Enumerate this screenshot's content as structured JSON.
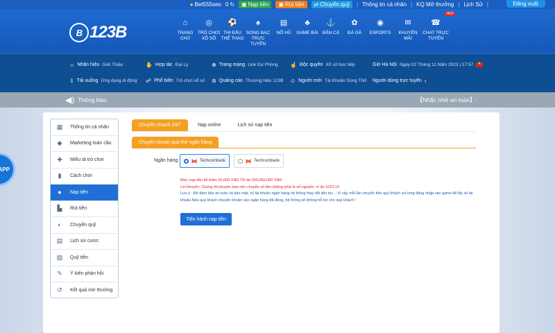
{
  "topbar": {
    "username": "Bet555seo",
    "balance": "0",
    "deposit": "Nạp tiền",
    "withdraw": "Rút tiền",
    "transfer": "Chuyển quỹ",
    "profile": "Thông tin cá nhân",
    "lottery_results": "KQ Mở thưởng",
    "history": "Lịch Sử",
    "logout": "Đăng xuất"
  },
  "logo": {
    "text": "123B",
    "mark": "B"
  },
  "nav": [
    {
      "icon": "home-icon",
      "line1": "TRANG CHỦ",
      "line2": ""
    },
    {
      "icon": "lottery-icon",
      "line1": "TRÒ CHƠI",
      "line2": "XỔ SỐ"
    },
    {
      "icon": "sports-icon",
      "line1": "THI ĐẤU",
      "line2": "THỂ THAO"
    },
    {
      "icon": "casino-icon",
      "line1": "SÒNG BẠC",
      "line2": "TRỰC TUYẾN"
    },
    {
      "icon": "slot-icon",
      "line1": "NỔ HŨ",
      "line2": ""
    },
    {
      "icon": "cards-icon",
      "line1": "GAME BÀI",
      "line2": ""
    },
    {
      "icon": "fish-icon",
      "line1": "BẮN CÁ",
      "line2": ""
    },
    {
      "icon": "cock-icon",
      "line1": "ĐÁ GÀ",
      "line2": ""
    },
    {
      "icon": "esports-icon",
      "line1": "ESPORTS",
      "line2": ""
    },
    {
      "icon": "gift-icon",
      "line1": "KHUYẾN MÃI",
      "line2": ""
    },
    {
      "icon": "chat-icon",
      "line1": "CHAT TRỰC",
      "line2": "TUYẾN"
    }
  ],
  "hot_badge": "HOT",
  "subbar": {
    "brand_label": "Nhãn hiệu",
    "brand_val": "Giới Thiệu",
    "download_label": "Tải xuống",
    "download_val": "Ứng dụng di động",
    "partner_label": "Hợp tác",
    "partner_val": "Đại Lý",
    "spread_label": "Phổ biến",
    "spread_val": "Trò chơi xổ số",
    "site_label": "Trang mạng",
    "site_val": "Link Dự Phòng",
    "ads_label": "Quảng cáo",
    "ads_val": "Thương hiệu 123B",
    "exclusive_label": "Độc quyền",
    "exclusive_val": "Xổ số trực tiếp",
    "newbie_label": "Người mới",
    "newbie_val": "Tài Khoản Dùng Thử",
    "time_label": "Giờ Hà Nội",
    "time_val": "Ngày 02 Tháng 11 Năm 2023 | 17:57",
    "online_label": "Người dùng trực tuyến"
  },
  "notice": {
    "label": "Thông báo:",
    "right": "【Nhắc nhở an toàn】:"
  },
  "app_badge": "APP",
  "sidebar": [
    {
      "icon": "profile-icon",
      "label": "Thông tin cá nhân"
    },
    {
      "icon": "diamond-icon",
      "label": "Marketing toàn cầu"
    },
    {
      "icon": "gamepad-icon",
      "label": "Miêu tả trò chơi"
    },
    {
      "icon": "book-icon",
      "label": "Cách chơi"
    },
    {
      "icon": "piggy-bank-icon",
      "label": "Nạp tiền"
    },
    {
      "icon": "withdraw-icon",
      "label": "Rút tiền"
    },
    {
      "icon": "transfer-icon",
      "label": "Chuyển quỹ"
    },
    {
      "icon": "history-icon",
      "label": "Lịch sử cược"
    },
    {
      "icon": "fund-icon",
      "label": "Quỹ tiền"
    },
    {
      "icon": "feedback-icon",
      "label": "Ý kiến phản hồi"
    },
    {
      "icon": "result-icon",
      "label": "Kết quả mở thưởng"
    }
  ],
  "tabs": [
    "Chuyển nhanh 24/7",
    "Nạp online",
    "Lịch sử nạp tiền"
  ],
  "subtab": "Chuyển khoản qua thẻ ngân hàng",
  "bank_label": "Ngân hàng",
  "banks": [
    "Techcombank",
    "Techcombank"
  ],
  "info": {
    "line1": "Mức nạp tiền tối thiểu 50,000 VND Tối đa 500,000,000 VND",
    "line2": "Lời khuyên: Chúng tôi khuyên bạn nên chuyển số tiền không phải là số nguyên, ví dụ 1023.13",
    "line3": "Lưu ý : Để đảm bảo an toàn và bảo mật, số tài khoản ngân hàng hệ thống thay đổi liên tục ...Vì vậy mỗi lần chuyển tiền quý khách vui lòng đăng nhập vào game để lấy số tài",
    "line4": "khoản.Nếu quý khách chuyển khoản vào ngân hàng đã đóng, hệ thống sẽ không hỗ trợ cho quý khách !"
  },
  "submit": "Tiến hành nạp tiền",
  "colors": {
    "primary": "#1f6fd6",
    "accent": "#f4a020",
    "header": "#1558b8",
    "subbar": "#0e4e92"
  }
}
